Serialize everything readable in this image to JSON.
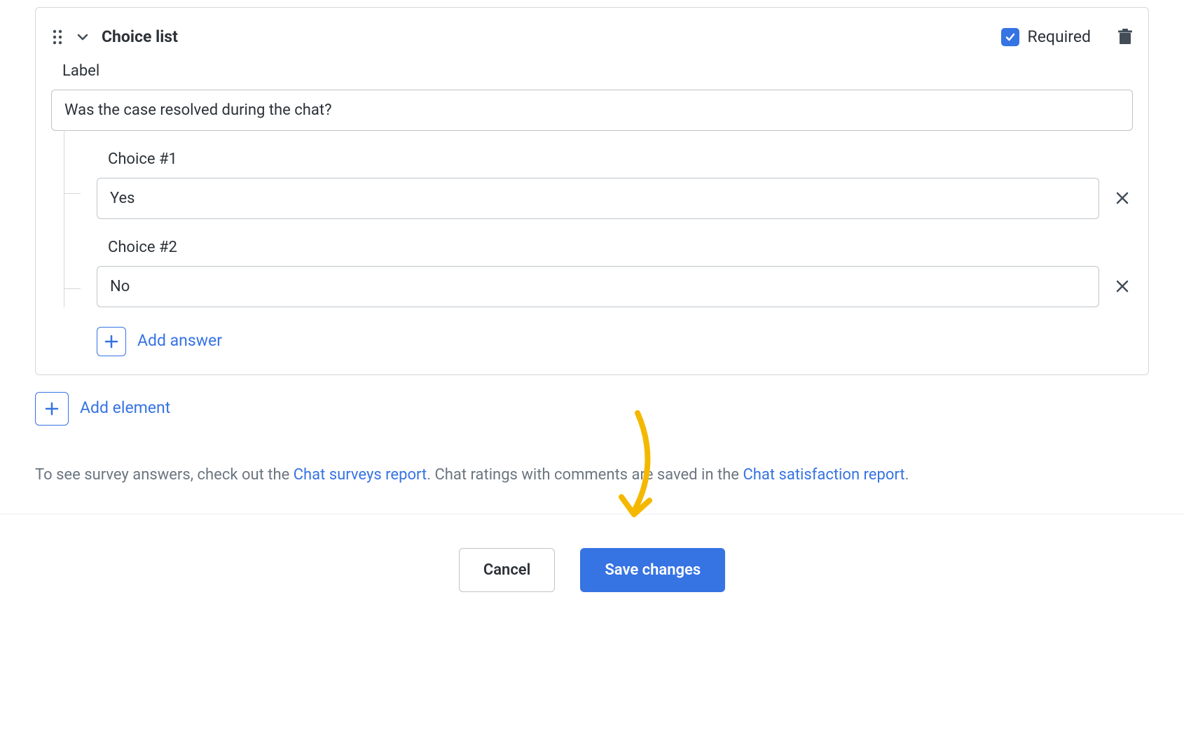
{
  "card": {
    "title": "Choice list",
    "required_label": "Required",
    "required_checked": true,
    "label_field_label": "Label",
    "label_value": "Was the case resolved during the chat?",
    "choices": [
      {
        "label": "Choice #1",
        "value": "Yes"
      },
      {
        "label": "Choice #2",
        "value": "No"
      }
    ],
    "add_answer_label": "Add answer"
  },
  "add_element_label": "Add element",
  "help": {
    "prefix": "To see survey answers, check out the ",
    "link1": "Chat surveys report",
    "middle": ". Chat ratings with comments are saved in the ",
    "link2": "Chat satisfaction report",
    "suffix": "."
  },
  "buttons": {
    "cancel": "Cancel",
    "save": "Save changes"
  }
}
